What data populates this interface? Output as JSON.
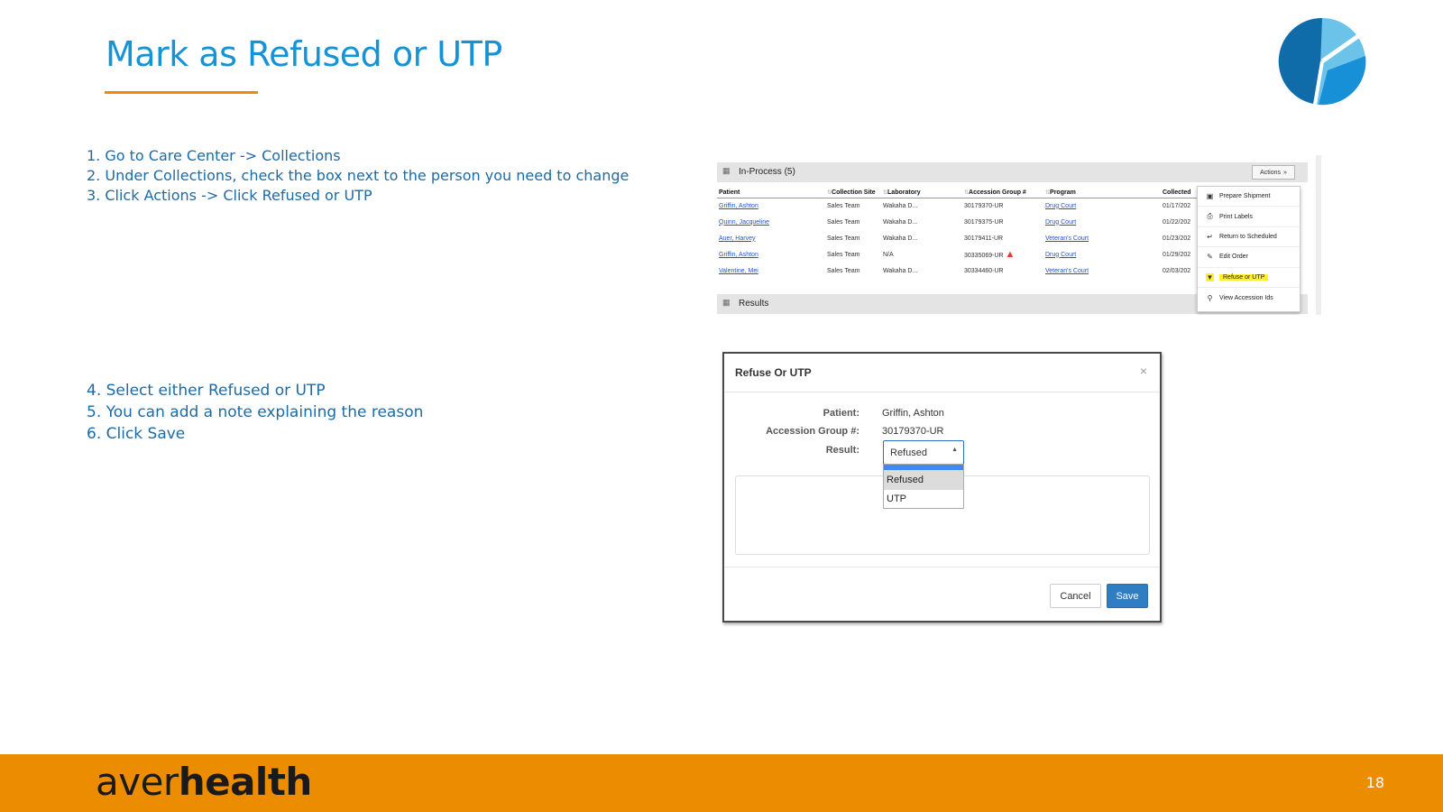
{
  "slide": {
    "title": "Mark as Refused or UTP",
    "page_number": "18",
    "brand_light": "aver",
    "brand_bold": "health",
    "colors": {
      "title": "#1493d6",
      "accent": "#ee8a00",
      "footer": "#ec8c00",
      "steps": "#1c6ba4"
    }
  },
  "steps_a": [
    "1. Go to Care Center -> Collections",
    "2. Under Collections, check the box next to the person you need to change",
    "3. Click Actions -> Click Refused or UTP"
  ],
  "steps_b": [
    "4. Select either Refused or UTP",
    "5. You can add a note explaining the reason",
    "6. Click Save"
  ],
  "collections": {
    "panel_title": "In-Process (5)",
    "actions_label": "Actions",
    "results_title": "Results",
    "columns": [
      "Patient",
      "Collection Site",
      "Laboratory",
      "Accession Group #",
      "Program",
      "Collected"
    ],
    "rows": [
      {
        "patient": "Griffin, Ashton",
        "site": "Sales Team",
        "lab": "Wakaha D...",
        "accession": "30179370-UR",
        "program": "Drug Court",
        "collected": "01/17/202"
      },
      {
        "patient": "Quinn, Jacqueline",
        "site": "Sales Team",
        "lab": "Wakaha D...",
        "accession": "30179375-UR",
        "program": "Drug Court",
        "collected": "01/22/202"
      },
      {
        "patient": "Auer, Harvey",
        "site": "Sales Team",
        "lab": "Wakaha D...",
        "accession": "30179411-UR",
        "program": "Veteran's Court",
        "collected": "01/23/202"
      },
      {
        "patient": "Griffin, Ashton",
        "site": "Sales Team",
        "lab": "N/A",
        "accession": "30335069-UR",
        "program": "Drug Court",
        "collected": "01/29/202"
      },
      {
        "patient": "Valentine, Mei",
        "site": "Sales Team",
        "lab": "Wakaha D...",
        "accession": "30334460-UR",
        "program": "Veteran's Court",
        "collected": "02/03/202"
      }
    ],
    "actions_menu": [
      {
        "label": "Prepare Shipment",
        "icon": "package-icon"
      },
      {
        "label": "Print Labels",
        "icon": "printer-icon"
      },
      {
        "label": "Return to Scheduled",
        "icon": "return-arrow-icon"
      },
      {
        "label": "Edit Order",
        "icon": "pencil-icon"
      },
      {
        "label": "Refuse or UTP",
        "icon": "thumbs-down-icon",
        "highlighted": true
      },
      {
        "label": "View Accession Ids",
        "icon": "magnifier-icon"
      }
    ]
  },
  "modal": {
    "title": "Refuse Or UTP",
    "patient_label": "Patient:",
    "patient_value": "Griffin, Ashton",
    "accession_label": "Accession Group #:",
    "accession_value": "30179370-UR",
    "result_label": "Result:",
    "result_selected": "Refused",
    "options": [
      "Refused",
      "UTP"
    ],
    "cancel_label": "Cancel",
    "save_label": "Save"
  }
}
